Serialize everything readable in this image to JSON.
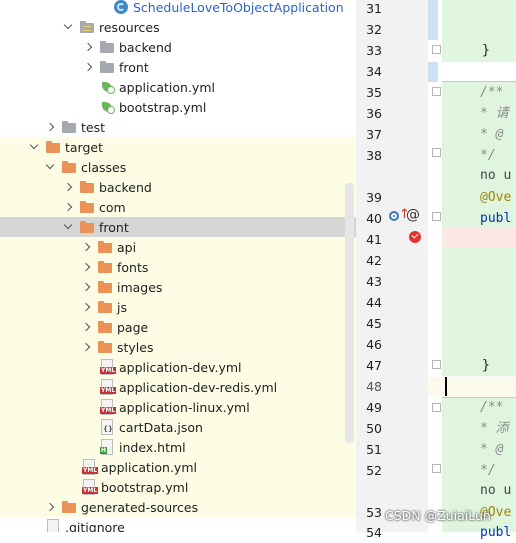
{
  "tree": {
    "items": [
      {
        "label": "ScheduleLoveToObjectApplication",
        "icon": "class-icon"
      },
      {
        "label": "resources",
        "icon": "resources-folder-icon"
      },
      {
        "label": "backend",
        "icon": "folder-icon"
      },
      {
        "label": "front",
        "icon": "folder-icon"
      },
      {
        "label": "application.yml",
        "icon": "spring-config-icon"
      },
      {
        "label": "bootstrap.yml",
        "icon": "spring-config-icon"
      },
      {
        "label": "test",
        "icon": "folder-icon"
      },
      {
        "label": "target",
        "icon": "excluded-folder-icon"
      },
      {
        "label": "classes",
        "icon": "excluded-folder-icon"
      },
      {
        "label": "backend",
        "icon": "excluded-folder-icon"
      },
      {
        "label": "com",
        "icon": "excluded-folder-icon"
      },
      {
        "label": "front",
        "icon": "excluded-folder-icon"
      },
      {
        "label": "api",
        "icon": "excluded-folder-icon"
      },
      {
        "label": "fonts",
        "icon": "excluded-folder-icon"
      },
      {
        "label": "images",
        "icon": "excluded-folder-icon"
      },
      {
        "label": "js",
        "icon": "excluded-folder-icon"
      },
      {
        "label": "page",
        "icon": "excluded-folder-icon"
      },
      {
        "label": "styles",
        "icon": "excluded-folder-icon"
      },
      {
        "label": "application-dev.yml",
        "icon": "yml-file-icon"
      },
      {
        "label": "application-dev-redis.yml",
        "icon": "yml-file-icon"
      },
      {
        "label": "application-linux.yml",
        "icon": "yml-file-icon"
      },
      {
        "label": "cartData.json",
        "icon": "json-file-icon"
      },
      {
        "label": "index.html",
        "icon": "html-file-icon"
      },
      {
        "label": "application.yml",
        "icon": "yml-file-icon"
      },
      {
        "label": "bootstrap.yml",
        "icon": "yml-file-icon"
      },
      {
        "label": "generated-sources",
        "icon": "excluded-folder-icon"
      },
      {
        "label": ".gitignore",
        "icon": "file-icon"
      }
    ],
    "selected": "front"
  },
  "gutter": {
    "line_numbers": [
      "31",
      "32",
      "33",
      "34",
      "35",
      "36",
      "37",
      "38",
      "39",
      "40",
      "41",
      "42",
      "43",
      "44",
      "45",
      "46",
      "47",
      "48",
      "49",
      "50",
      "51",
      "52",
      "53",
      "54"
    ]
  },
  "editor": {
    "lines": {
      "l33": "}",
      "l35": "/**",
      "l36": " * 请",
      "l37": " * @",
      "l38": " */",
      "l38b": "no u",
      "l39": "@Ove",
      "l40": "publ",
      "l47": "}",
      "l49": "/**",
      "l50": " * 添",
      "l51": " * @",
      "l52": " */",
      "l52b": "no u",
      "l53": "@Ove",
      "l54": "publ"
    }
  },
  "watermark": "CSDN @ZuiaiLun",
  "colors": {
    "accent": "#ea9257",
    "selection": "#d5d5d5",
    "excluded_bg": "#fdfde6",
    "added_bg": "#dff5dd",
    "keyword": "#0033b3"
  }
}
